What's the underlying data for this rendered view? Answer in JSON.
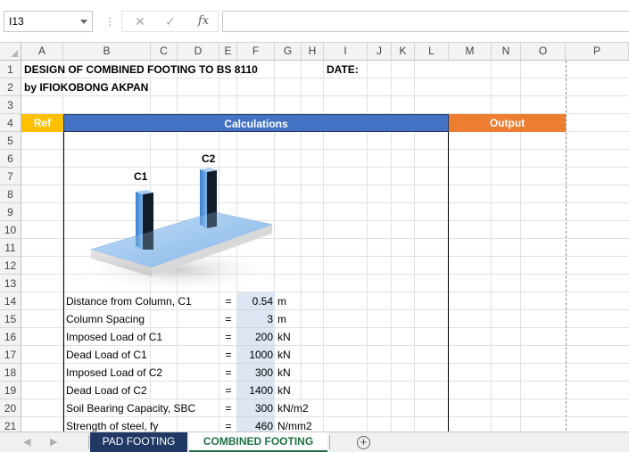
{
  "formula_bar": {
    "name_box": "I13",
    "cancel_icon": "✕",
    "enter_icon": "✓",
    "fx_label": "fx",
    "formula": ""
  },
  "columns": [
    "A",
    "B",
    "C",
    "D",
    "E",
    "F",
    "G",
    "H",
    "I",
    "J",
    "K",
    "L",
    "M",
    "N",
    "O",
    "P"
  ],
  "rows": [
    "1",
    "2",
    "3",
    "4",
    "5",
    "6",
    "7",
    "8",
    "9",
    "10",
    "11",
    "12",
    "13",
    "14",
    "15",
    "16",
    "17",
    "18",
    "19",
    "20",
    "21"
  ],
  "sheet": {
    "title": "DESIGN OF COMBINED FOOTING TO BS 8110",
    "author": "by IFIOKOBONG AKPAN",
    "date_label": "DATE:",
    "headers": {
      "ref": "Ref",
      "calculations": "Calculations",
      "output": "Output"
    },
    "figure_labels": {
      "c1": "C1",
      "c2": "C2"
    },
    "inputs": [
      {
        "label": "Distance from Column, C1",
        "eq": "=",
        "value": "0.54",
        "unit": "m"
      },
      {
        "label": "Column Spacing",
        "eq": "=",
        "value": "3",
        "unit": "m"
      },
      {
        "label": "Imposed Load of C1",
        "eq": "=",
        "value": "200",
        "unit": "kN"
      },
      {
        "label": "Dead Load of C1",
        "eq": "=",
        "value": "1000",
        "unit": "kN"
      },
      {
        "label": "Imposed Load of C2",
        "eq": "=",
        "value": "300",
        "unit": "kN"
      },
      {
        "label": "Dead Load of C2",
        "eq": "=",
        "value": "1400",
        "unit": "kN"
      },
      {
        "label": "Soil Bearing Capacity, SBC",
        "eq": "=",
        "value": "300",
        "unit": "kN/m2"
      },
      {
        "label": "Strength of steel, fy",
        "eq": "=",
        "value": "460",
        "unit": "N/mm2"
      }
    ]
  },
  "tabs": {
    "prev_icon": "◀",
    "next_icon": "▶",
    "items": [
      {
        "label": "PAD FOOTING",
        "active": false
      },
      {
        "label": "COMBINED FOOTING",
        "active": true
      }
    ],
    "add_icon": "+"
  },
  "colors": {
    "ref_header": "#ffc000",
    "calc_header": "#4472c4",
    "output_header": "#ed7d31",
    "input_fill": "#dde6f2",
    "active_tab_text": "#1e7145",
    "inactive_tab_bg": "#203864"
  }
}
